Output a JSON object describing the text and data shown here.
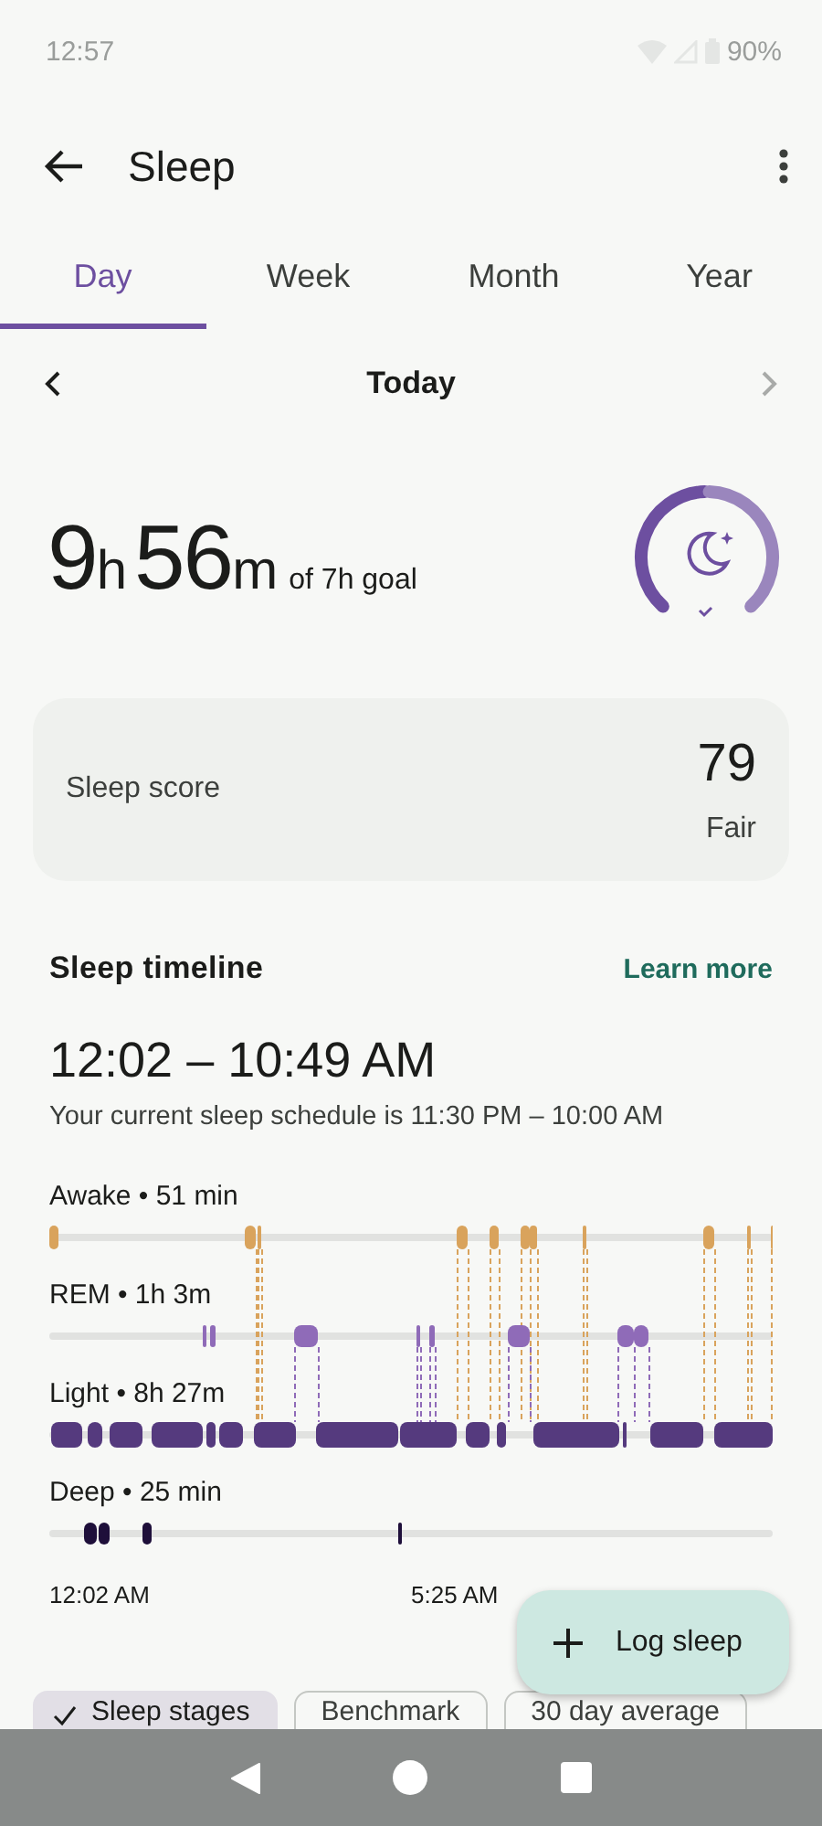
{
  "status_bar": {
    "time": "12:57",
    "battery": "90%"
  },
  "app_bar": {
    "title": "Sleep"
  },
  "tabs": [
    {
      "label": "Day",
      "selected": true
    },
    {
      "label": "Week",
      "selected": false
    },
    {
      "label": "Month",
      "selected": false
    },
    {
      "label": "Year",
      "selected": false
    }
  ],
  "date_nav": {
    "label": "Today",
    "next_disabled": true
  },
  "summary": {
    "hours": "9",
    "hours_unit": "h",
    "minutes": "56",
    "minutes_unit": "m",
    "goal": "of 7h goal"
  },
  "score_card": {
    "label": "Sleep score",
    "value": "79",
    "rating": "Fair"
  },
  "timeline": {
    "title": "Sleep timeline",
    "link": "Learn more",
    "range": "12:02 – 10:49 AM",
    "schedule": "Your current sleep schedule is 11:30 PM – 10:00 AM",
    "stages": [
      {
        "kind": "awake",
        "label": "Awake • 51 min"
      },
      {
        "kind": "rem",
        "label": "REM • 1h 3m"
      },
      {
        "kind": "light",
        "label": "Light • 8h 27m"
      },
      {
        "kind": "deep",
        "label": "Deep • 25 min"
      }
    ],
    "axis_labels": [
      "12:02 AM",
      "5:25 AM"
    ]
  },
  "fab": {
    "label": "Log sleep"
  },
  "chips": [
    {
      "label": "Sleep stages",
      "selected": true
    },
    {
      "label": "Benchmark",
      "selected": false
    },
    {
      "label": "30 day average",
      "selected": false
    }
  ]
}
